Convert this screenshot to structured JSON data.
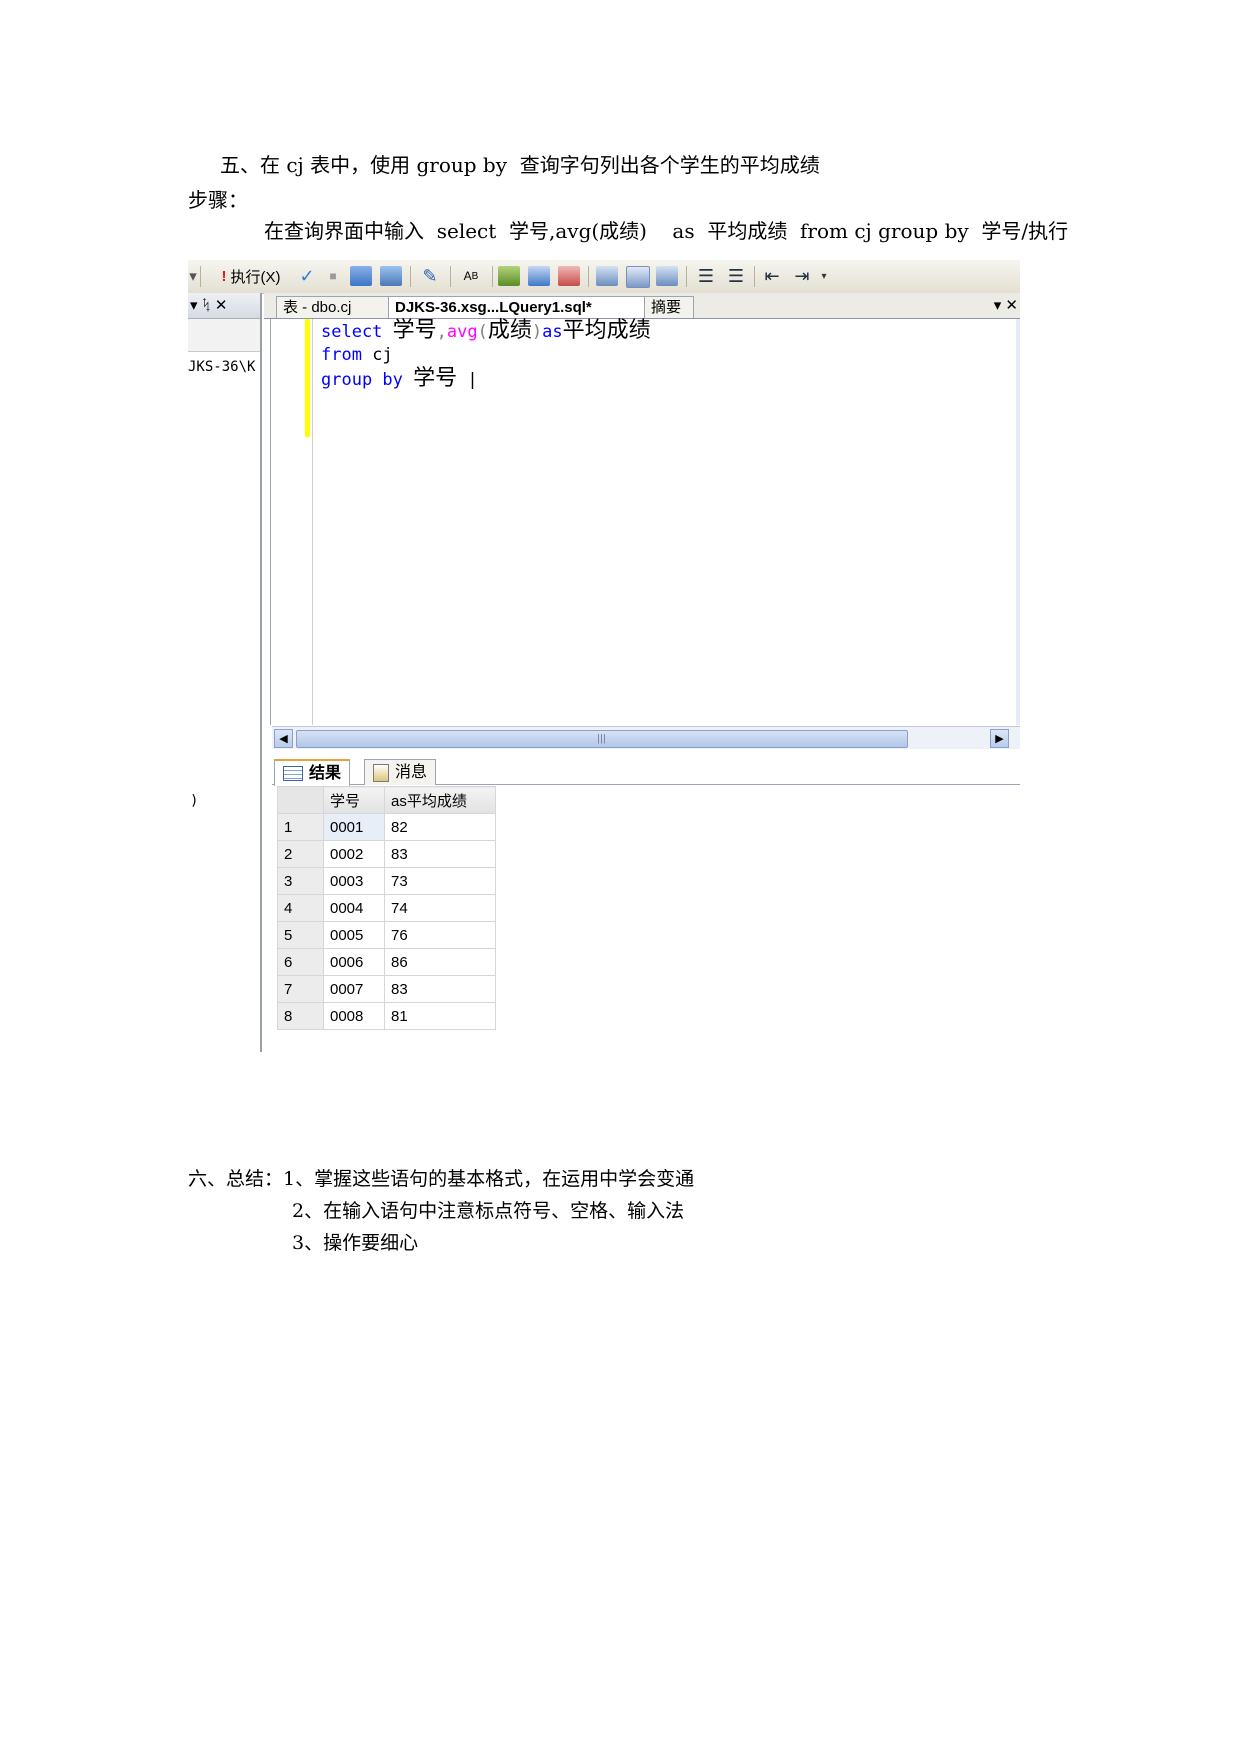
{
  "doc": {
    "heading": "五、在 cj 表中，使用 group by  查询字句列出各个学生的平均成绩",
    "steps_label": "步骤：",
    "instruction": "在查询界面中输入  select  学号,avg(成绩)    as  平均成绩  from cj group by  学号/执行",
    "summary": [
      "六、总结：1、掌握这些语句的基本格式，在运用中学会变通",
      "2、在输入语句中注意标点符号、空格、输入法",
      "3、操作要细心"
    ]
  },
  "toolbar": {
    "execute_label": "执行(X)",
    "items": [
      "execute-icon",
      "check-icon",
      "stop-icon",
      "query-icon",
      "design-icon",
      "edit-icon",
      "font-icon",
      "plan-icon",
      "indexes-icon",
      "options-icon",
      "results-text-icon",
      "results-grid-icon",
      "results-file-icon",
      "comment-icon",
      "uncomment-icon",
      "outdent-icon",
      "indent-icon"
    ]
  },
  "left_pane": {
    "header_controls": "▾ ᛪ ✕",
    "server_text": "JKS-36\\K",
    "stray_char": ")"
  },
  "editor_tabs": [
    {
      "label": "表 - dbo.cj",
      "active": false
    },
    {
      "label": "DJKS-36.xsg...LQuery1.sql*",
      "active": true
    },
    {
      "label": "摘要",
      "active": false
    }
  ],
  "editor_tab_controls": "▾ ✕",
  "code": {
    "line1_select": "select ",
    "line1_col": "学号",
    "line1_comma": ",",
    "line1_avg": "avg",
    "line1_lparen": "(",
    "line1_arg": "成绩",
    "line1_rparen": ")",
    "line1_as": "as",
    "line1_alias": "平均成绩",
    "line2_from": "from ",
    "line2_table": "cj",
    "line3_groupby": "group by ",
    "line3_col": "学号",
    "caret": "|"
  },
  "result_tabs": [
    {
      "label": "结果",
      "icon": "grid-icon",
      "active": true
    },
    {
      "label": "消息",
      "icon": "message-icon",
      "active": false
    }
  ],
  "results": {
    "columns": [
      "学号",
      "as平均成绩"
    ],
    "rows": [
      {
        "n": "1",
        "id": "0001",
        "avg": "82"
      },
      {
        "n": "2",
        "id": "0002",
        "avg": "83"
      },
      {
        "n": "3",
        "id": "0003",
        "avg": "73"
      },
      {
        "n": "4",
        "id": "0004",
        "avg": "74"
      },
      {
        "n": "5",
        "id": "0005",
        "avg": "76"
      },
      {
        "n": "6",
        "id": "0006",
        "avg": "86"
      },
      {
        "n": "7",
        "id": "0007",
        "avg": "83"
      },
      {
        "n": "8",
        "id": "0008",
        "avg": "81"
      }
    ]
  },
  "colors": {
    "keyword": "#0000ff",
    "function": "#ff00ff",
    "change_bar": "#ffff00",
    "selection": "#e8eef8"
  }
}
